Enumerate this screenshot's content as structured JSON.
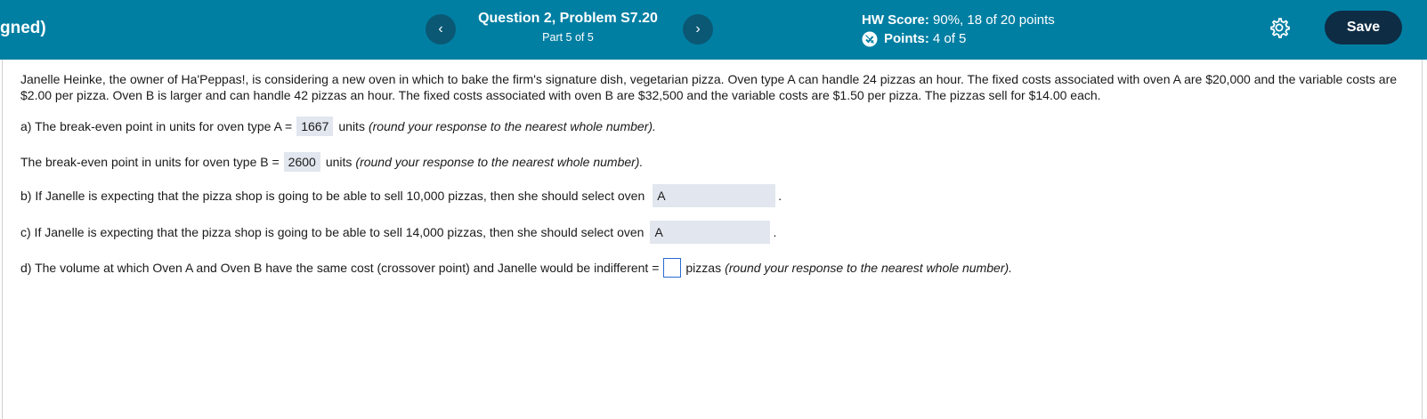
{
  "header": {
    "assignment_title": "gned)",
    "question_title": "Question 2, Problem S7.20",
    "part": "Part 5 of 5",
    "hw_score_label": "HW Score:",
    "hw_score_value": "90%, 18 of 20 points",
    "points_label": "Points:",
    "points_value": "4 of 5",
    "save_label": "Save",
    "prev_glyph": "‹",
    "next_glyph": "›",
    "settings_icon": "gear-icon",
    "points_icon": "partial-credit-icon"
  },
  "problem": {
    "intro": "Janelle Heinke, the owner of Ha'Peppas!, is considering a new oven in which to bake the firm's signature dish, vegetarian pizza. Oven type A can handle 24 pizzas an hour. The fixed costs associated with oven A are $20,000 and the variable costs are $2.00 per pizza. Oven B is larger and can handle 42 pizzas an hour. The fixed costs associated with oven B are  $32,500 and the variable costs are $1.50 per pizza. The pizzas sell for $14.00 each.",
    "a_prefix": "a) The break-even point in units for oven type A =",
    "a_value": "1667",
    "a_units": "units",
    "a_hint": "(round your response to the nearest whole number).",
    "a2_prefix": "The break-even point in units for oven type B =",
    "a2_value": "2600",
    "a2_units": "units",
    "a2_hint": "(round your response to the nearest whole number).",
    "b_prefix": "b) If Janelle is expecting that the pizza shop is going to be able to sell 10,000 pizzas, then she should select oven",
    "b_value": "A",
    "b_suffix": ".",
    "c_prefix": "c) If Janelle is expecting that the pizza shop is going to be able to sell 14,000 pizzas, then she should select oven",
    "c_value": "A",
    "c_suffix": ".",
    "d_prefix": "d) The volume at which Oven A and Oven B have the same cost (crossover point) and Janelle would be indifferent =",
    "d_value": "",
    "d_units": "pizzas",
    "d_hint": "(round your response to the nearest whole number)."
  },
  "colors": {
    "header_bg": "#007fa3",
    "nav_button_bg": "#0b5874",
    "save_button_bg": "#0e2c44",
    "answer_bg": "#e2e6ee",
    "input_border": "#2a6bd1"
  }
}
